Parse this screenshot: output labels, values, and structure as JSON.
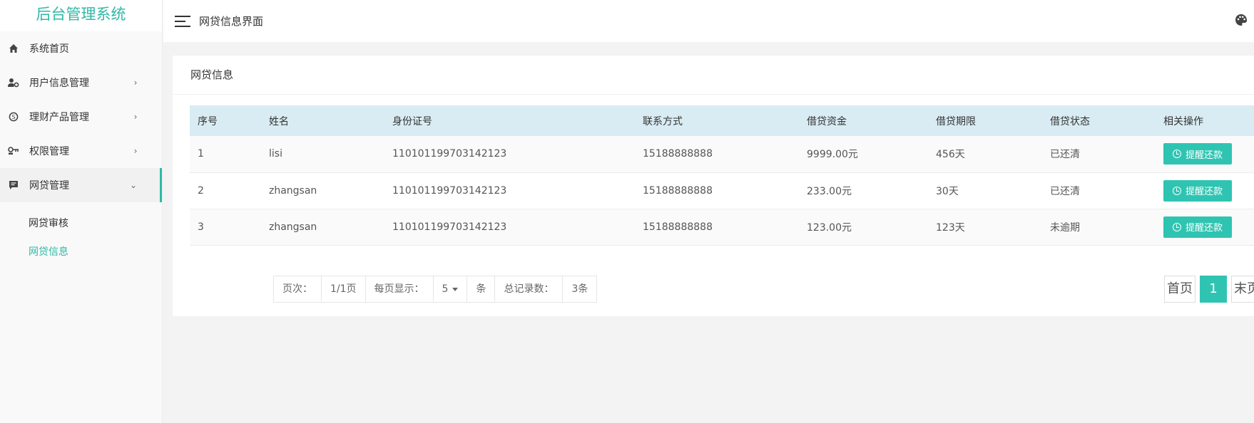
{
  "brand": "后台管理系统",
  "header": {
    "page_title": "网贷信息界面"
  },
  "sidebar": {
    "items": [
      {
        "label": "系统首页",
        "icon": "home-icon",
        "arrow": ""
      },
      {
        "label": "用户信息管理",
        "icon": "user-settings-icon",
        "arrow": "›"
      },
      {
        "label": "理财产品管理",
        "icon": "skype-icon",
        "arrow": "›"
      },
      {
        "label": "权限管理",
        "icon": "key-icon",
        "arrow": "›"
      },
      {
        "label": "网贷管理",
        "icon": "message-icon",
        "arrow": "⌄"
      }
    ],
    "submenu": [
      {
        "label": "网贷审核"
      },
      {
        "label": "网贷信息"
      }
    ]
  },
  "card": {
    "title": "网贷信息"
  },
  "table": {
    "columns": [
      "序号",
      "姓名",
      "身份证号",
      "联系方式",
      "借贷资金",
      "借贷期限",
      "借贷状态",
      "相关操作"
    ],
    "rows": [
      {
        "no": "1",
        "name": "lisi",
        "id": "110101199703142123",
        "phone": "15188888888",
        "amount": "9999.00元",
        "term": "456天",
        "status": "已还清",
        "action": "提醒还款"
      },
      {
        "no": "2",
        "name": "zhangsan",
        "id": "110101199703142123",
        "phone": "15188888888",
        "amount": "233.00元",
        "term": "30天",
        "status": "已还清",
        "action": "提醒还款"
      },
      {
        "no": "3",
        "name": "zhangsan",
        "id": "110101199703142123",
        "phone": "15188888888",
        "amount": "123.00元",
        "term": "123天",
        "status": "未逾期",
        "action": "提醒还款"
      }
    ]
  },
  "pagination": {
    "page_label": "页次：",
    "page_value": "1/1页",
    "per_page_label": "每页显示：",
    "per_page_value": "5",
    "per_page_unit": "条",
    "total_label": "总记录数：",
    "total_value": "3条",
    "first": "首页",
    "current": "1",
    "last": "末页"
  },
  "colors": {
    "accent": "#2fc4b2",
    "brand": "#2fb9a6",
    "table_header": "#d9ecf3"
  }
}
